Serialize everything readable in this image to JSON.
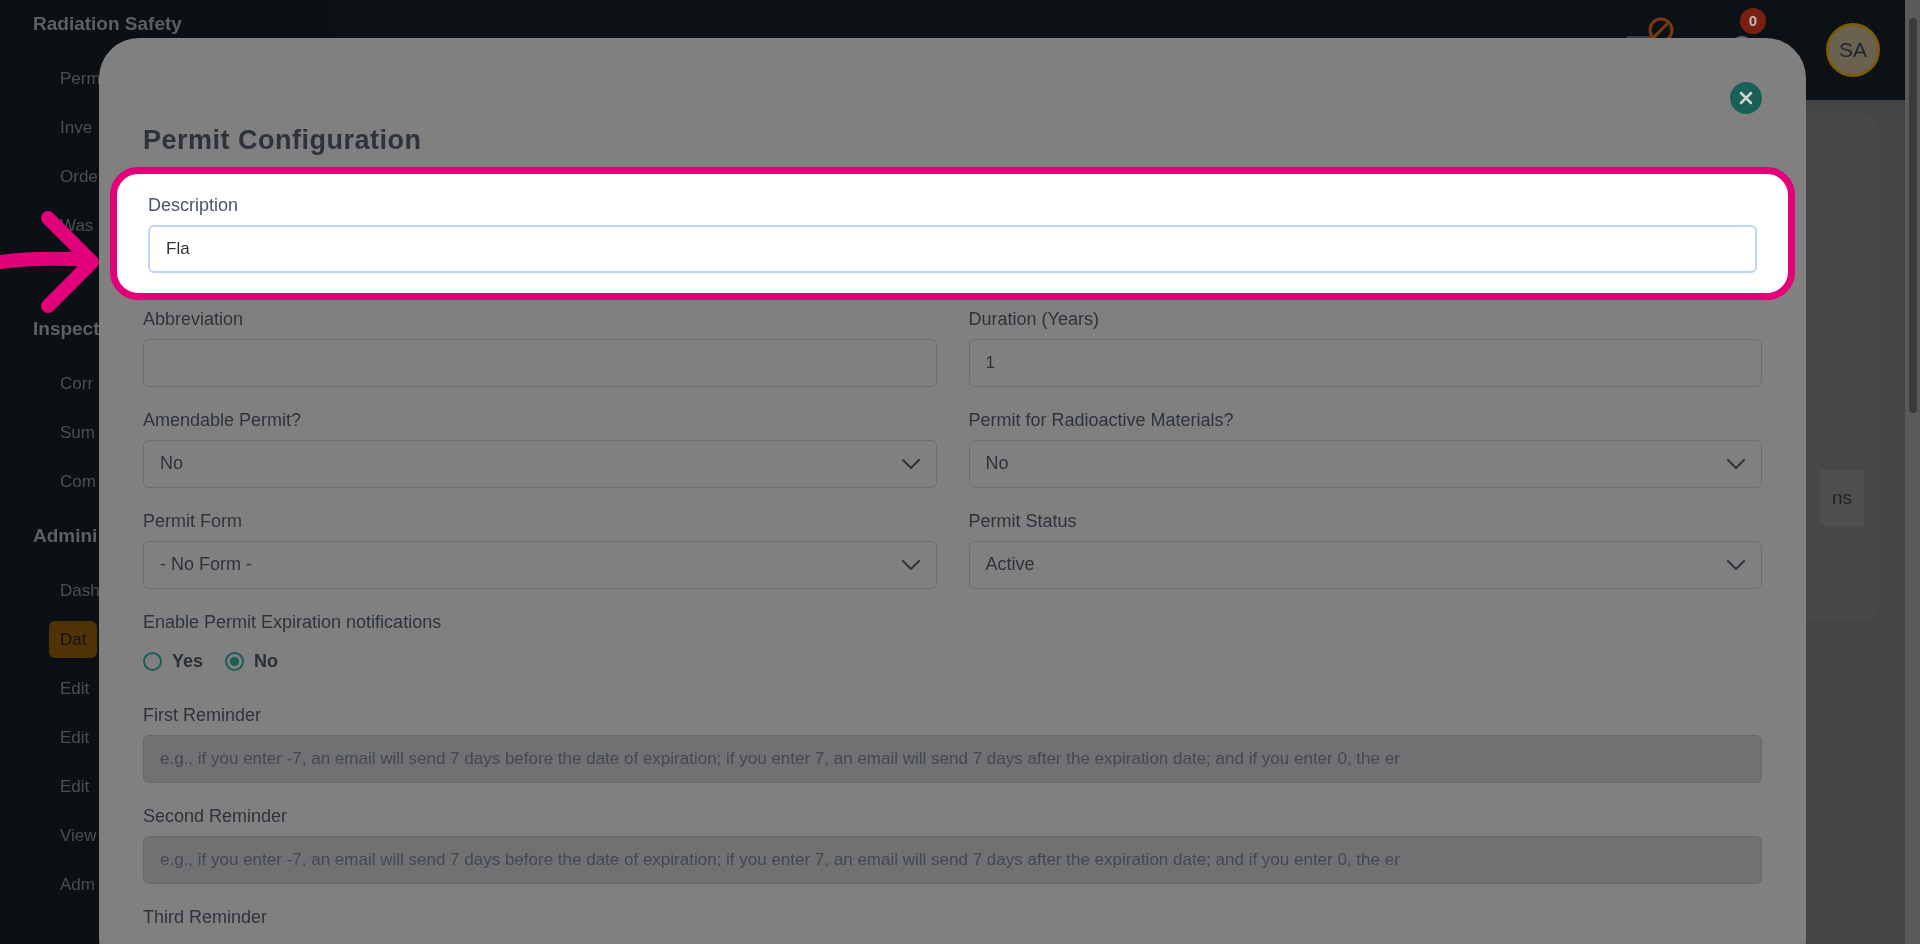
{
  "sidebar": {
    "entries": [
      {
        "kind": "heading",
        "label": "Radiation Safety",
        "selected": false
      },
      {
        "kind": "item",
        "label": "Perm",
        "selected": false
      },
      {
        "kind": "item",
        "label": "Inve",
        "selected": false
      },
      {
        "kind": "item",
        "label": "Orde",
        "selected": false
      },
      {
        "kind": "item",
        "label": "Was",
        "selected": false
      },
      {
        "kind": "gap"
      },
      {
        "kind": "heading",
        "label": "Inspect",
        "selected": false
      },
      {
        "kind": "item",
        "label": "Corr",
        "selected": false
      },
      {
        "kind": "item",
        "label": "Sum",
        "selected": false
      },
      {
        "kind": "item",
        "label": "Com",
        "selected": false
      },
      {
        "kind": "heading",
        "label": "Admini",
        "selected": false
      },
      {
        "kind": "item",
        "label": "Dash",
        "selected": false
      },
      {
        "kind": "item",
        "label": "Dat",
        "selected": true
      },
      {
        "kind": "item",
        "label": "Edit",
        "selected": false
      },
      {
        "kind": "item",
        "label": "Edit",
        "selected": false
      },
      {
        "kind": "item",
        "label": "Edit",
        "selected": false
      },
      {
        "kind": "item",
        "label": "View",
        "selected": false
      },
      {
        "kind": "item",
        "label": "Adm",
        "selected": false
      }
    ]
  },
  "header": {
    "notification_count": "0",
    "avatar": "SA"
  },
  "background_button": "ns",
  "modal": {
    "title": "Permit Configuration",
    "fields": [
      {
        "kind": "text",
        "label": "Description",
        "value": "Fla",
        "full": true,
        "highlighted": true
      },
      {
        "kind": "text",
        "label": "Abbreviation",
        "full": false
      },
      {
        "kind": "text",
        "label": "Duration (Years)",
        "value": "1",
        "full": false
      },
      {
        "kind": "select",
        "label": "Amendable Permit?",
        "value": "No",
        "full": false
      },
      {
        "kind": "select",
        "label": "Permit for Radioactive Materials?",
        "value": "No",
        "full": false
      },
      {
        "kind": "select",
        "label": "Permit Form",
        "value": "- No Form -",
        "full": false
      },
      {
        "kind": "select",
        "label": "Permit Status",
        "value": "Active",
        "full": false
      },
      {
        "kind": "radio",
        "label": "Enable Permit Expiration notifications",
        "full": true,
        "options": [
          {
            "label": "Yes",
            "selected": false
          },
          {
            "label": "No",
            "selected": true
          }
        ]
      },
      {
        "kind": "text",
        "label": "First Reminder",
        "placeholder": "e.g., if you enter -7, an email will send 7 days before the date of expiration; if you enter 7, an email will send 7 days after the expiration date; and if you enter 0, the er",
        "full": true,
        "disabled": true
      },
      {
        "kind": "text",
        "label": "Second Reminder",
        "placeholder": "e.g., if you enter -7, an email will send 7 days before the date of expiration; if you enter 7, an email will send 7 days after the expiration date; and if you enter 0, the er",
        "full": true,
        "disabled": true
      },
      {
        "kind": "cut_off",
        "label": "Third Reminder"
      }
    ]
  }
}
